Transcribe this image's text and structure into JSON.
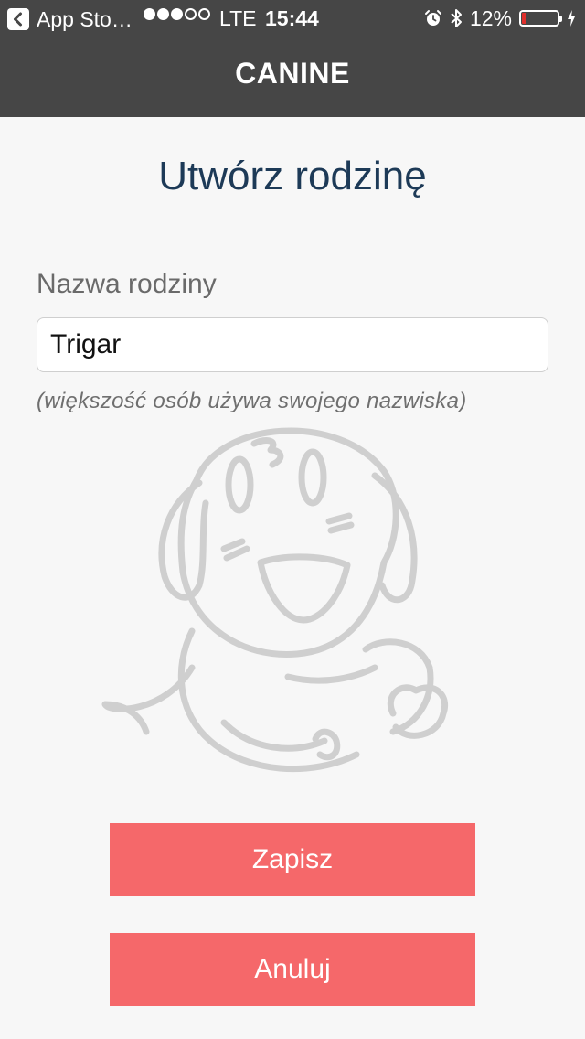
{
  "status_bar": {
    "back_app": "App Sto…",
    "signal_dots_filled": 3,
    "signal_dots_total": 5,
    "network": "LTE",
    "time": "15:44",
    "battery_percent": "12%",
    "battery_level": 0.12
  },
  "nav": {
    "title": "CANINE"
  },
  "form": {
    "title": "Utwórz rodzinę",
    "family_name_label": "Nazwa rodziny",
    "family_name_value": "Trigar",
    "hint": "(większość osób używa swojego nazwiska)"
  },
  "buttons": {
    "save": "Zapisz",
    "cancel": "Anuluj"
  },
  "colors": {
    "navbar": "#464646",
    "title": "#1d3a57",
    "button": "#f5686a",
    "background": "#f7f7f7"
  }
}
